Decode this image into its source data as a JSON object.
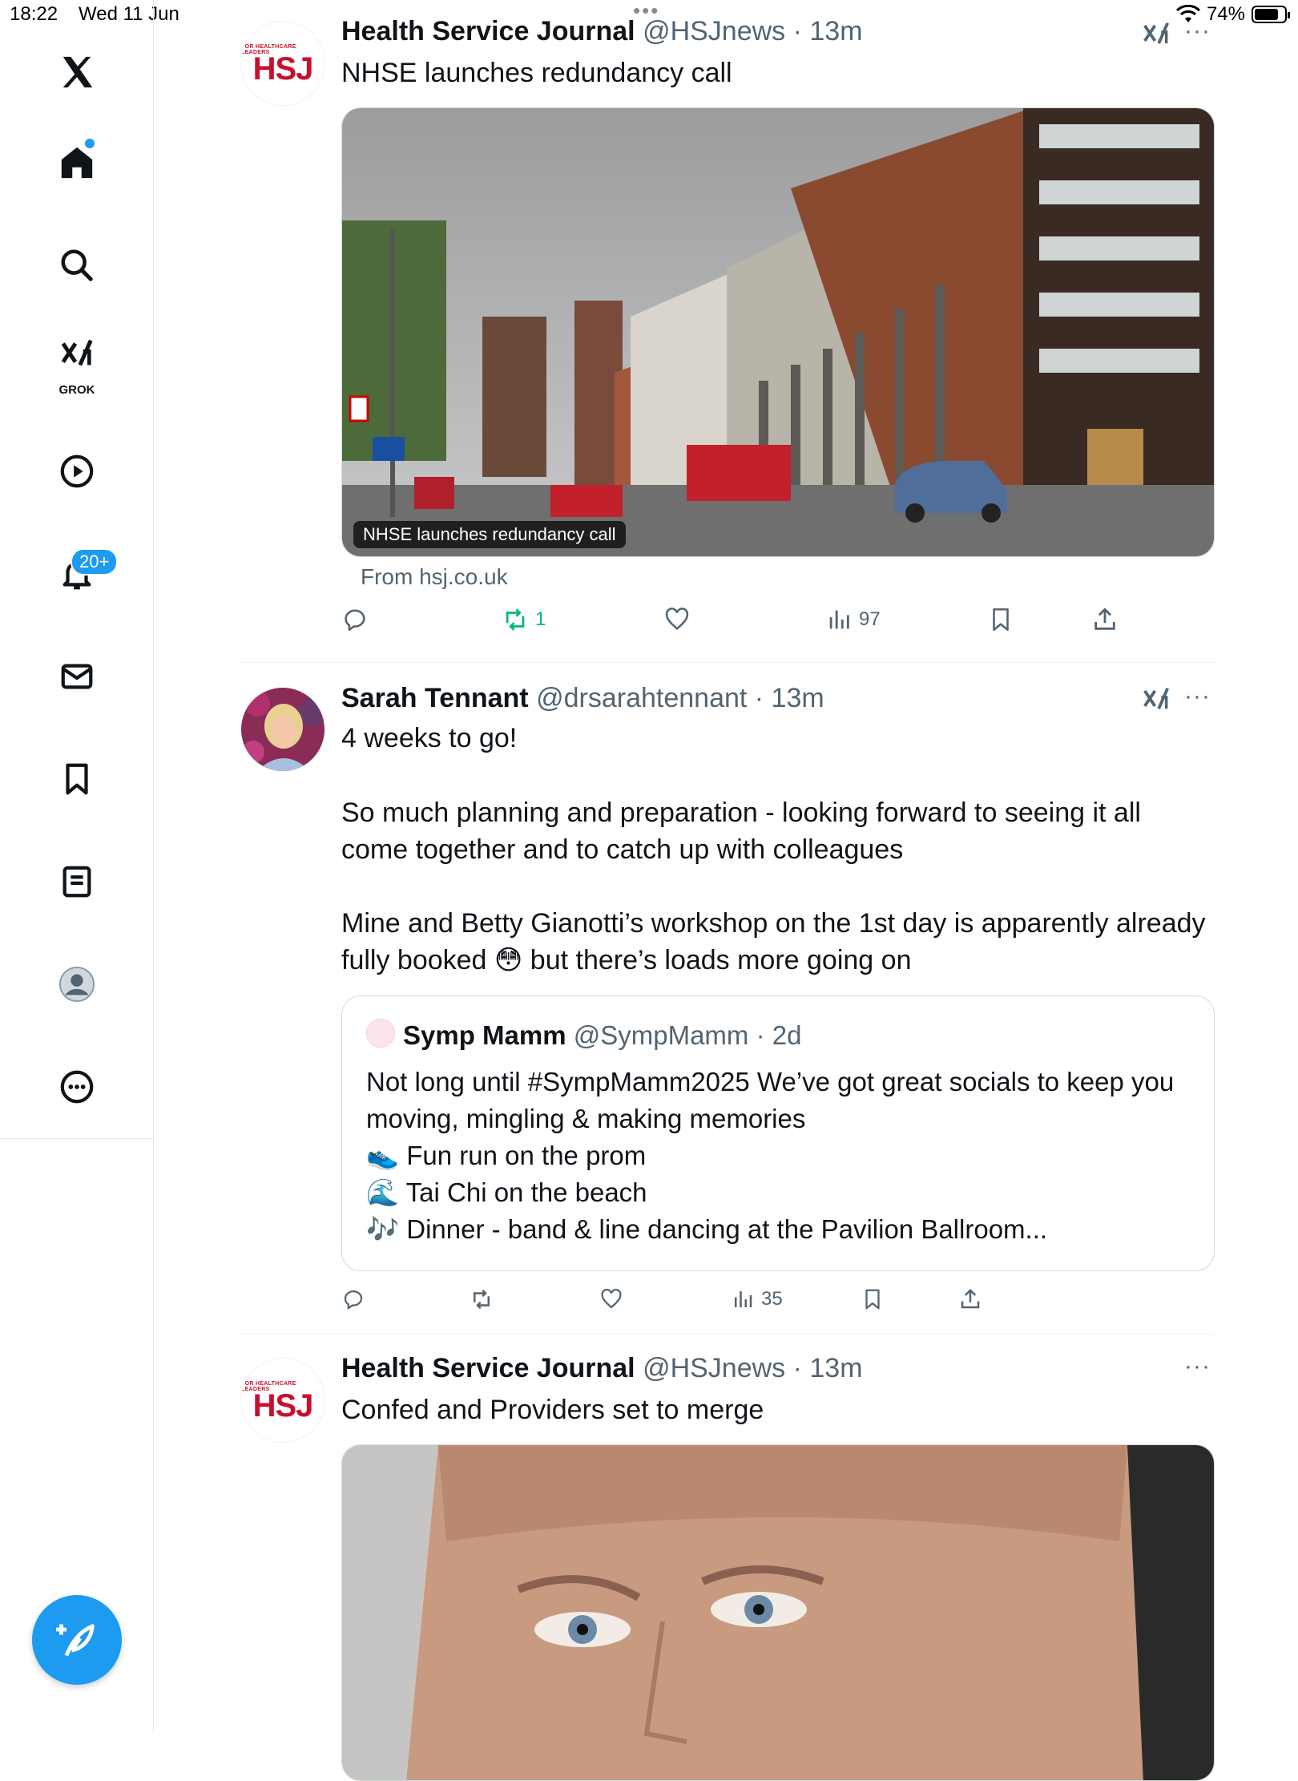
{
  "status_bar": {
    "time": "18:22",
    "date": "Wed 11 Jun",
    "battery": "74%"
  },
  "sidebar": {
    "grok_label": "GROK",
    "notifications_badge": "20+"
  },
  "tweets": [
    {
      "author_name": "Health Service Journal",
      "author_meta": "@HSJnews · 13m",
      "avatar_small": "FOR HEALTHCARE LEADERS",
      "avatar_text": "HSJ",
      "text": "NHSE launches redundancy call",
      "media_caption": "NHSE launches redundancy call",
      "source": "From hsj.co.uk",
      "retweets": "1",
      "views": "97"
    },
    {
      "author_name": "Sarah Tennant",
      "author_meta": "@drsarahtennant · 13m",
      "text_line1": "4 weeks to go!",
      "text_line2": "So much planning and preparation - looking forward to seeing it all come together and to catch up with colleagues",
      "text_line3": "Mine and Betty Gianotti’s workshop on the 1st day is apparently already fully booked 😳 but there’s loads more going on",
      "views": "35",
      "quote": {
        "author_name": "Symp Mamm",
        "author_meta": "@SympMamm · 2d",
        "line1": "Not long until #SympMamm2025 We’ve got great socials to keep you moving, mingling & making memories",
        "line2": "👟 Fun run on the prom",
        "line3": "🌊 Tai Chi on the beach",
        "line4": "🎶 Dinner - band & line dancing at the Pavilion Ballroom..."
      }
    },
    {
      "author_name": "Health Service Journal",
      "author_meta": "@HSJnews · 13m",
      "avatar_small": "FOR HEALTHCARE LEADERS",
      "avatar_text": "HSJ",
      "text": "Confed and Providers set to merge"
    }
  ],
  "icons": {
    "more": "···",
    "status_dots": "•••"
  },
  "colors": {
    "accent": "#1d9bf0",
    "retweet_green": "#00ba7c",
    "hsj_red": "#c8102e"
  }
}
